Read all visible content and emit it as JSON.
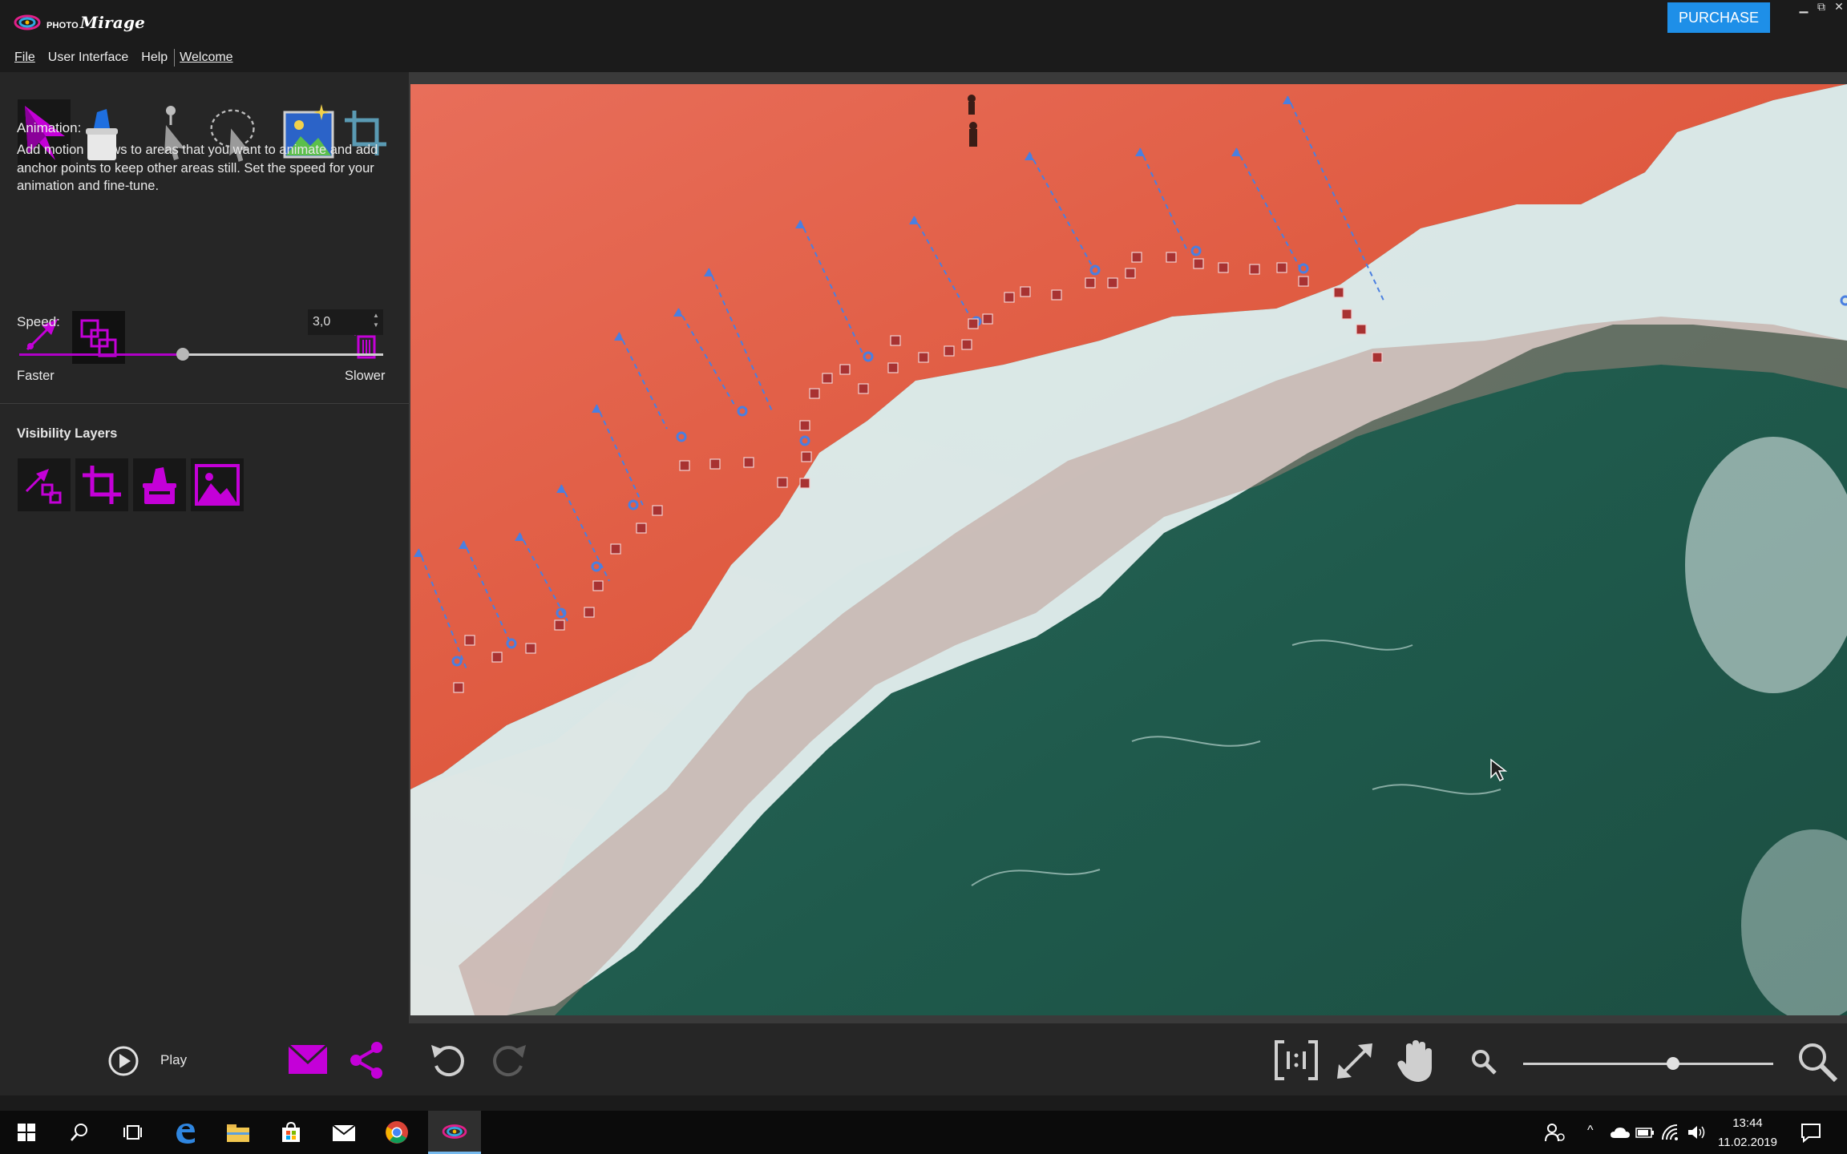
{
  "app": {
    "name_small": "PHOTO",
    "name_main": "Mirage",
    "purchase_label": "PURCHASE",
    "window_controls": [
      "minimize-icon",
      "restore-icon",
      "close-icon"
    ]
  },
  "menu": {
    "items": [
      "File",
      "User Interface",
      "Help",
      "Welcome"
    ]
  },
  "tools": [
    {
      "icon": "animation-arrow-icon",
      "active": true
    },
    {
      "icon": "eraser-icon",
      "active": false
    },
    {
      "icon": "pin-select-icon",
      "active": false
    },
    {
      "icon": "lasso-select-icon",
      "active": false
    },
    {
      "icon": "sky-image-icon",
      "active": false
    },
    {
      "icon": "crop-icon",
      "active": false
    }
  ],
  "animation": {
    "title": "Animation:",
    "description": "Add motion arrows to areas that you want to animate and add anchor points to keep other areas still. Set the speed for your animation and fine-tune.",
    "sub_tools": [
      "motion-arrow-icon",
      "anchor-points-icon",
      "clear-all-icon"
    ]
  },
  "speed": {
    "label": "Speed:",
    "value": "3,0",
    "slider_fraction": 0.45,
    "min_label": "Faster",
    "max_label": "Slower"
  },
  "visibility_layers": {
    "title": "Visibility Layers",
    "icons": [
      "arrows-layer-icon",
      "crop-layer-icon",
      "mask-layer-icon",
      "image-layer-icon"
    ]
  },
  "bottom": {
    "play_label": "Play",
    "zoom_fraction": 0.6
  },
  "taskbar": {
    "time": "13:44",
    "date": "11.02.2019"
  },
  "colors": {
    "accent_magenta": "#b000c8",
    "purchase_blue": "#1e8fe8",
    "motion_arrow_blue": "#4a7fe0",
    "anchor_red": "#a83232"
  }
}
